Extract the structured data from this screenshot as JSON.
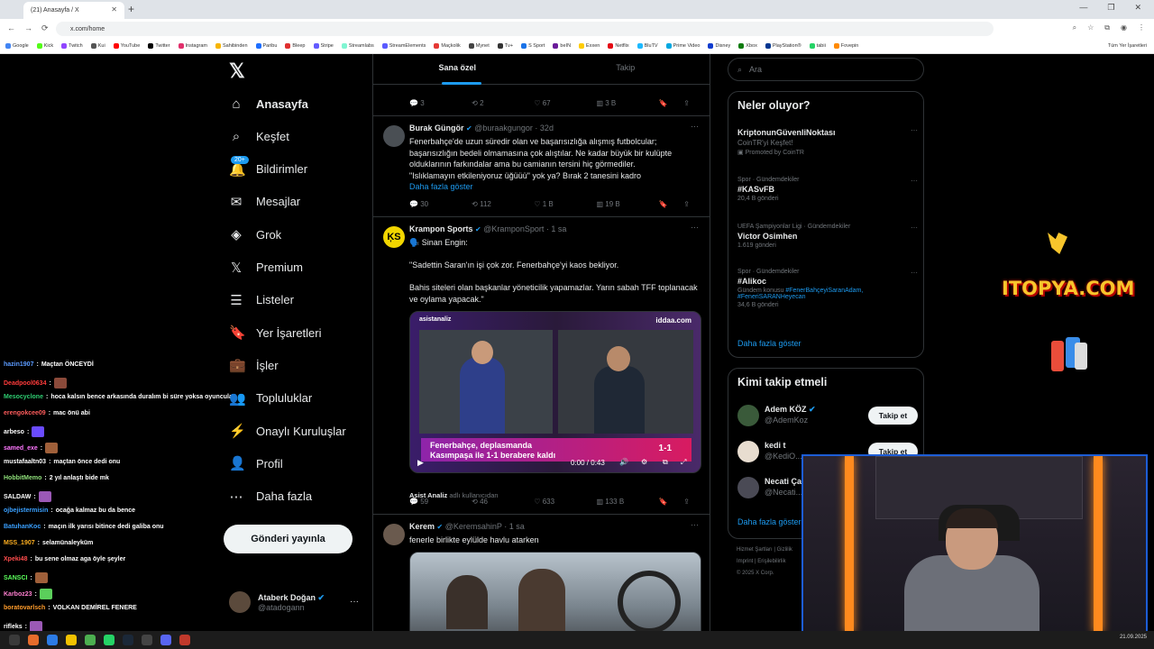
{
  "browser": {
    "tab_title": "(21) Anasayfa / X",
    "url": "x.com/home",
    "bookmarks": [
      "Google",
      "Kick",
      "Twitch",
      "Kui",
      "YouTube",
      "Twitter",
      "Instagram",
      "Sahibinden",
      "Paribu",
      "Bleep",
      "Stripe",
      "Streamlabs",
      "StreamElements",
      "Maçkolik",
      "Mynet",
      "Tv+",
      "S Sport",
      "beIN",
      "Exxen",
      "Netflix",
      "BluTV",
      "Prime Video",
      "Disney",
      "Xbox",
      "PlayStation®",
      "tabii",
      "Fovepin"
    ],
    "bookmark_colors": [
      "#4285f4",
      "#53fc18",
      "#9146ff",
      "#555555",
      "#ff0000",
      "#000000",
      "#e1306c",
      "#f7b500",
      "#1e6fff",
      "#e03030",
      "#635bff",
      "#80f5d2",
      "#5a5aff",
      "#e53935",
      "#444444",
      "#333333",
      "#1a73e8",
      "#6a1b9a",
      "#ffcc00",
      "#e50914",
      "#1db9ff",
      "#00a8e1",
      "#113ccf",
      "#107c10",
      "#003791",
      "#25d366",
      "#ff8a00"
    ],
    "all_bookmarks": "Tüm Yer İşaretleri"
  },
  "sidebar": {
    "badge": "20+",
    "items": [
      {
        "label": "Anasayfa",
        "icon": "home-icon"
      },
      {
        "label": "Keşfet",
        "icon": "search-icon"
      },
      {
        "label": "Bildirimler",
        "icon": "bell-icon"
      },
      {
        "label": "Mesajlar",
        "icon": "mail-icon"
      },
      {
        "label": "Grok",
        "icon": "grok-icon"
      },
      {
        "label": "Premium",
        "icon": "x-premium-icon"
      },
      {
        "label": "Listeler",
        "icon": "list-icon"
      },
      {
        "label": "Yer İşaretleri",
        "icon": "bookmark-icon"
      },
      {
        "label": "İşler",
        "icon": "briefcase-icon"
      },
      {
        "label": "Topluluklar",
        "icon": "people-icon"
      },
      {
        "label": "Onaylı Kuruluşlar",
        "icon": "lightning-icon"
      },
      {
        "label": "Profil",
        "icon": "person-icon"
      },
      {
        "label": "Daha fazla",
        "icon": "more-circle-icon"
      }
    ],
    "post_button": "Gönderi yayınla",
    "account_name": "Ataberk Doğan",
    "account_handle": "@atadogann"
  },
  "timeline": {
    "tabs": [
      "Sana özel",
      "Takip"
    ],
    "top_actions": {
      "reply": "3",
      "repost": "2",
      "like": "67",
      "views": "3 B"
    },
    "tweets": [
      {
        "name": "Burak Güngör",
        "handle": "@buraakgungor · 32d",
        "text": "Fenerbahçe'de uzun süredir olan ve başarısızlığa alışmış futbolcular; başarısızlığın bedeli olmamasına çok alıştılar. Ne kadar büyük bir kulüpte olduklarının farkındalar ama bu camianın tersini hiç görmediler.\n\"Islıklamayın etkileniyoruz üğüüü\" yok ya? Bırak 2 tanesini kadro",
        "show_more": "Daha fazla göster",
        "reply": "30",
        "repost": "112",
        "like": "1 B",
        "views": "19 B"
      },
      {
        "name": "Krampon Sports",
        "handle": "@KramponSport · 1 sa",
        "text": "🗣️ Sinan Engin:\n\n\"Sadettin Saran'ın işi çok zor. Fenerbahçe'yi kaos bekliyor.\n\nBahis siteleri olan başkanlar yöneticilik yapamazlar. Yarın sabah TFF toplanacak ve oylama yapacak.\"",
        "video_brand_left": "asistanaliz",
        "video_brand_right": "iddaa.com",
        "video_banner_1": "Fenerbahçe, deplasmanda",
        "video_banner_2": "Kasımpaşa ile 1-1 berabere kaldı",
        "video_score": "1-1",
        "video_time": "0:00 / 0:43",
        "tagged": "Asist Analiz",
        "tagged_suffix": "adlı kullanıcıdan",
        "reply": "59",
        "repost": "46",
        "like": "633",
        "views": "133 B"
      },
      {
        "name": "Kerem",
        "handle": "@KeremsahinP · 1 sa",
        "text": "fenerle birlikte eylülde havlu atarken"
      }
    ]
  },
  "right": {
    "search_placeholder": "Ara",
    "trends_title": "Neler oluyor?",
    "trends": [
      {
        "name": "KriptonunGüvenliNoktası",
        "sub": "CoinTR'yi Keşfet!",
        "promo": "Promoted by CoinTR"
      },
      {
        "cat": "Spor · Gündemdekiler",
        "name": "#KASvFB",
        "count": "20,4 B gönderi"
      },
      {
        "cat": "UEFA Şampiyonlar Ligi · Gündemdekiler",
        "name": "Victor Osimhen",
        "count": "1.619 gönderi"
      },
      {
        "cat": "Spor · Gündemdekiler",
        "name": "#Alikoc",
        "topic_prefix": "Gündem konusu",
        "topic_links": "#FenerBahçeyiSaranAdam, #FeneriSARANHeyecan",
        "count": "34,6 B gönderi"
      }
    ],
    "show_more": "Daha fazla göster",
    "who_title": "Kimi takip etmeli",
    "who": [
      {
        "name": "Adem KÖZ",
        "handle": "@AdemKoz",
        "btn": "Takip et"
      },
      {
        "name": "kedi t",
        "handle": "@KediO...",
        "btn": "Takip et"
      },
      {
        "name": "Necati Ça...",
        "handle": "@Necati..."
      }
    ],
    "footer_1": "Hizmet Şartları | Gizlilik",
    "footer_2": "Imprint | Erişilebilirlik",
    "footer_3": "© 2025 X Corp."
  },
  "chat": [
    {
      "user": "hazin1907",
      "color": "#5b9bff",
      "msg": "Maçtan ÖNCEYDİ"
    },
    {
      "user": "Deadpool0634",
      "color": "#ff3b3b",
      "msg": ""
    },
    {
      "user": "Mesocyclone",
      "color": "#2ecc71",
      "msg": "hoca kalsın bence arkasında duralım bi süre yoksa oyuncular"
    },
    {
      "user": "erengokcee09",
      "color": "#ff5c5c",
      "msg": "mac önü abi"
    },
    {
      "user": "arbeso",
      "color": "#ffffff",
      "msg": ""
    },
    {
      "user": "samed_exe",
      "color": "#ff77ff",
      "msg": ""
    },
    {
      "user": "mustafaaltn03",
      "color": "#ffffff",
      "msg": "maçtan önce dedi onu"
    },
    {
      "user": "HobbitMemo",
      "color": "#8fe07a",
      "msg": "2 yıl anlaştı bide mk"
    },
    {
      "user": "SALDAW",
      "color": "#ffffff",
      "msg": ""
    },
    {
      "user": "ojbejistermisin",
      "color": "#3aa0ff",
      "msg": "ocağa kalmaz bu da bence"
    },
    {
      "user": "BatuhanKoc",
      "color": "#3aa0ff",
      "msg": "maçın ilk yarısı bitince dedi galiba onu"
    },
    {
      "user": "MSS_1907",
      "color": "#ffb020",
      "msg": "selamünaleyküm"
    },
    {
      "user": "Xpeki48",
      "color": "#ff4d4d",
      "msg": "bu sene olmaz aga öyle şeyler"
    },
    {
      "user": "SANSCI",
      "color": "#5bff5b",
      "msg": ""
    },
    {
      "user": "Karboz23",
      "color": "#ff7fd0",
      "msg": ""
    },
    {
      "user": "boratovarlsch",
      "color": "#ff9c2b",
      "msg": "VOLKAN DEMİREL FENERE"
    },
    {
      "user": "rifleks",
      "color": "#ffffff",
      "msg": ""
    }
  ],
  "overlay": {
    "sponsor": "ITOPYA.COM"
  },
  "taskbar": {
    "clock": "21.09.2025"
  }
}
